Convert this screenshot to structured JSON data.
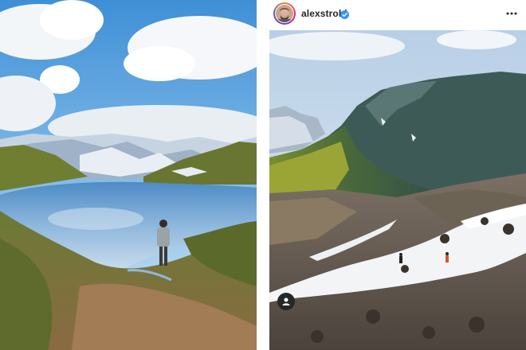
{
  "post": {
    "username": "alexstrohl",
    "verified": true,
    "more_icon": "more-horizontal-icon",
    "tag_icon": "user-tag-icon"
  },
  "colors": {
    "verified_badge": "#3897f0",
    "username_text": "#262626"
  }
}
